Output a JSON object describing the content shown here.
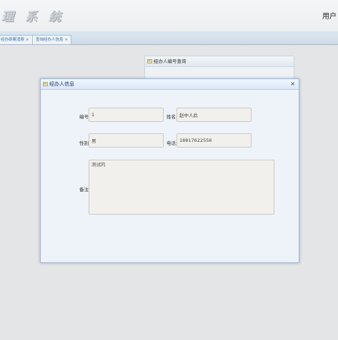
{
  "header": {
    "system_title": "理 系 统",
    "user_label": "用户"
  },
  "tabs": [
    {
      "label": "经办部案消费",
      "close": "×"
    },
    {
      "label": "查询经办人信息",
      "close": "×"
    }
  ],
  "background_panel": {
    "title": "经办人编号查询"
  },
  "dialog": {
    "title": "经办人信息",
    "close": "×",
    "form": {
      "id_label": "编号:",
      "id_value": "1",
      "name_label": "姓名:",
      "name_value": "赵中人此",
      "gender_label": "性别:",
      "gender_value": "男",
      "phone_label": "电话:",
      "phone_value": "18817622556",
      "remark_label": "备注:",
      "remark_value": "测试的"
    }
  }
}
